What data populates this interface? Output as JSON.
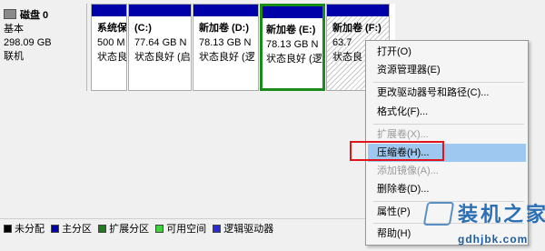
{
  "disk": {
    "title": "磁盘 0",
    "type": "基本",
    "size": "298.09 GB",
    "status": "联机"
  },
  "partitions": [
    {
      "name": "系统保",
      "size": "500 M",
      "status": "状态良"
    },
    {
      "name": "(C:)",
      "size": "77.64 GB N",
      "status": "状态良好 (启"
    },
    {
      "name": "新加卷 (D:)",
      "size": "78.13 GB N",
      "status": "状态良好 (逻"
    },
    {
      "name": "新加卷 (E:)",
      "size": "78.13 GB N",
      "status": "状态良好 (逻"
    },
    {
      "name": "新加卷 (F:)",
      "size": "63.7",
      "status": "状态良"
    }
  ],
  "context_menu": {
    "open": "打开(O)",
    "explorer": "资源管理器(E)",
    "change_letter": "更改驱动器号和路径(C)...",
    "format": "格式化(F)...",
    "extend": "扩展卷(X)...",
    "shrink": "压缩卷(H)...",
    "add_mirror": "添加镜像(A)...",
    "delete": "删除卷(D)...",
    "properties": "属性(P)",
    "help": "帮助(H)"
  },
  "legend": [
    {
      "label": "未分配",
      "color": "#000000"
    },
    {
      "label": "主分区",
      "color": "#0000a8"
    },
    {
      "label": "扩展分区",
      "color": "#1e7b1e"
    },
    {
      "label": "可用空间",
      "color": "#3fd13f"
    },
    {
      "label": "逻辑驱动器",
      "color": "#2a2ad8"
    }
  ],
  "watermark": {
    "title": "装机之家",
    "url": "gdhjbk.com"
  },
  "colors": {
    "primary_partition_bar": "#0000a8",
    "selected_border": "#1a8c1a",
    "menu_highlight": "#9ec8ef",
    "red_annotation": "#e0141b"
  }
}
